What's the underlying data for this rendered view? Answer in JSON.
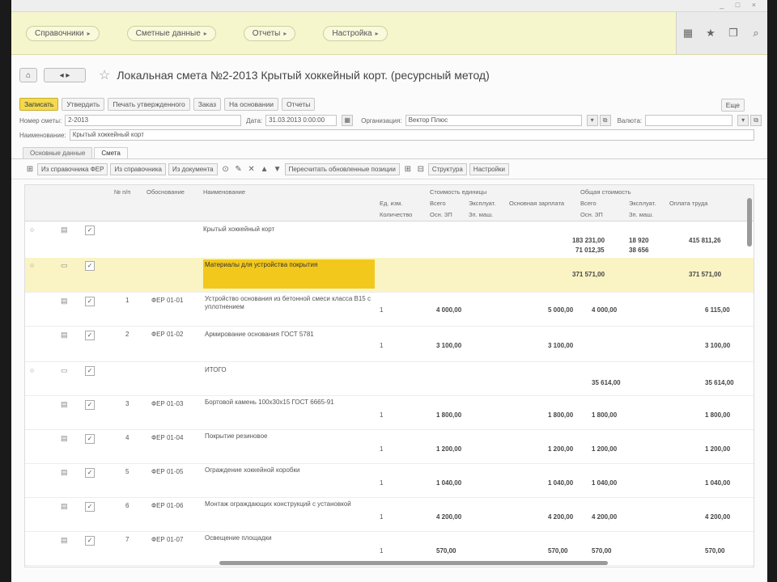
{
  "window": {
    "title": "Локальная смета №2-2013 Крытый хоккейный корт. (ресурсный метод)"
  },
  "sections": [
    {
      "label": "Справочники"
    },
    {
      "label": "Сметные данные"
    },
    {
      "label": "Отчеты"
    },
    {
      "label": "Настройка"
    }
  ],
  "toolbar": {
    "save_label": "Записать",
    "cmd2": "Утвердить",
    "cmd3": "Печать утвержденного",
    "cmd4": "Заказ",
    "cmd5": "На основании",
    "cmd6": "Отчеты",
    "more": "Еще"
  },
  "fields": {
    "number_label": "Номер сметы:",
    "number_value": "2-2013",
    "date_label": "Дата:",
    "date_value": "31.03.2013 0:00:00",
    "org_label": "Организация:",
    "org_value": "Вектор Плюс",
    "unit_label": "Валюта:",
    "name_label": "Наименование:",
    "name_value": "Крытый хоккейный корт"
  },
  "tabs": [
    {
      "label": "Основные данные"
    },
    {
      "label": "Смета"
    }
  ],
  "gridbar": {
    "btn1": "Из справочника ФЕР",
    "btn2": "Из справочника",
    "btn3": "Из документа",
    "btn4": "Пересчитать обновленные позиции",
    "btn5": "Структура",
    "btn6": "Настройки"
  },
  "grid_head": {
    "col_num": "№ п/п",
    "col_code": "Обоснование",
    "col_name": "Наименование",
    "col_qty": "Ед. изм.",
    "col_qty2": "Количество",
    "group1": "Стоимость единицы",
    "g1a": "Всего",
    "g1b": "Эксплуат.",
    "g1c": "Основная зарплата",
    "group2": "Общая стоимость",
    "g2a": "Всего",
    "g2b": "Эксплуат.",
    "g2c": "Оплата труда",
    "sub1": "Осн. ЗП",
    "sub2": "Зп. маш.",
    "sub3": "Осн. ЗП",
    "sub4": "Зп. маш."
  },
  "rows": [
    {
      "num": "",
      "code": "",
      "name": "Крытый хоккейный корт",
      "qty": "",
      "p1": "",
      "p2": "",
      "p3": "",
      "t1": "183 231,00",
      "t2": "18 920",
      "t3": "415 811,26",
      "t4": "71 012,35",
      "t5": "38 656"
    },
    {
      "num": "",
      "code": "",
      "name": "Материалы для устройства покрытия",
      "qty": "",
      "p1": "",
      "p2": "",
      "p3": "",
      "t1": "371 571,00",
      "t2": "",
      "t3": "371 571,00",
      "t4": "",
      "t5": ""
    },
    {
      "num": "1",
      "code": "ФЕР 01-01",
      "name": "Устройство основания из бетонной смеси класса В15 с уплотнением",
      "qty": "1",
      "p1": "4 000,00",
      "p2": "",
      "p3": "5 000,00",
      "t1": "4 000,00",
      "t2": "",
      "t3": "6 115,00",
      "t4": "",
      "t5": ""
    },
    {
      "num": "2",
      "code": "ФЕР 01-02",
      "name": "Армирование основания ГОСТ 5781",
      "qty": "1",
      "p1": "3 100,00",
      "p2": "",
      "p3": "3 100,00",
      "t1": "",
      "t2": "",
      "t3": "3 100,00",
      "t4": "",
      "t5": ""
    },
    {
      "num": "",
      "code": "",
      "name": "ИТОГО",
      "qty": "",
      "p1": "",
      "p2": "",
      "p3": "",
      "t1": "35 614,00",
      "t2": "",
      "t3": "35 614,00",
      "t4": "",
      "t5": ""
    },
    {
      "num": "3",
      "code": "ФЕР 01-03",
      "name": "Бортовой камень 100х30х15 ГОСТ 6665-91",
      "qty": "1",
      "p1": "1 800,00",
      "p2": "",
      "p3": "1 800,00",
      "t1": "1 800,00",
      "t2": "",
      "t3": "1 800,00",
      "t4": "",
      "t5": ""
    },
    {
      "num": "4",
      "code": "ФЕР 01-04",
      "name": "Покрытие резиновое",
      "qty": "1",
      "p1": "1 200,00",
      "p2": "",
      "p3": "1 200,00",
      "t1": "1 200,00",
      "t2": "",
      "t3": "1 200,00",
      "t4": "",
      "t5": ""
    },
    {
      "num": "5",
      "code": "ФЕР 01-05",
      "name": "Ограждение хоккейной коробки",
      "qty": "1",
      "p1": "1 040,00",
      "p2": "",
      "p3": "1 040,00",
      "t1": "1 040,00",
      "t2": "",
      "t3": "1 040,00",
      "t4": "",
      "t5": ""
    },
    {
      "num": "6",
      "code": "ФЕР 01-06",
      "name": "Монтаж ограждающих конструкций с установкой",
      "qty": "1",
      "p1": "4 200,00",
      "p2": "",
      "p3": "4 200,00",
      "t1": "4 200,00",
      "t2": "",
      "t3": "4 200,00",
      "t4": "",
      "t5": ""
    },
    {
      "num": "7",
      "code": "ФЕР 01-07",
      "name": "Освещение площадки",
      "qty": "1",
      "p1": "570,00",
      "p2": "",
      "p3": "570,00",
      "t1": "570,00",
      "t2": "",
      "t3": "570,00",
      "t4": "",
      "t5": ""
    }
  ]
}
